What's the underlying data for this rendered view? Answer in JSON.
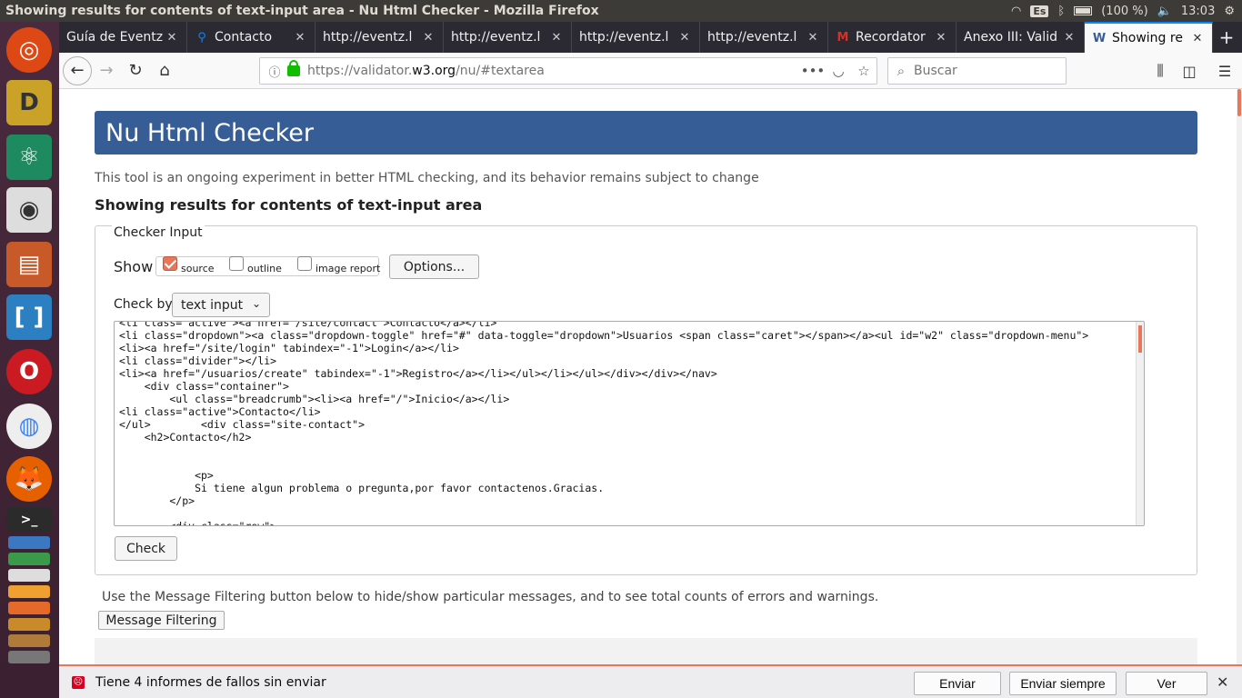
{
  "window": {
    "title": "Showing results for contents of text-input area - Nu Html Checker - Mozilla Firefox"
  },
  "tray": {
    "keyboard": "Es",
    "battery": "(100 %)",
    "time": "13:03"
  },
  "tabs": [
    {
      "label": "Guía de Eventz",
      "favicon": ""
    },
    {
      "label": "Contacto",
      "favicon": "map-pin"
    },
    {
      "label": "http://eventz.l",
      "favicon": ""
    },
    {
      "label": "http://eventz.l",
      "favicon": ""
    },
    {
      "label": "http://eventz.l",
      "favicon": ""
    },
    {
      "label": "http://eventz.l",
      "favicon": ""
    },
    {
      "label": "Recordator",
      "favicon": "gmail"
    },
    {
      "label": "Anexo III: Valid",
      "favicon": ""
    },
    {
      "label": "Showing re",
      "favicon": "w3c",
      "active": true
    }
  ],
  "urlbar": {
    "prefix": "https://validator.",
    "host": "w3.org",
    "path": "/nu/#textarea",
    "more": "•••"
  },
  "searchbar": {
    "placeholder": "Buscar"
  },
  "page": {
    "banner": "Nu Html Checker",
    "tagline": "This tool is an ongoing experiment in better HTML checking, and its behavior remains subject to change",
    "results_heading": "Showing results for contents of text-input area",
    "legend": "Checker Input",
    "show_label": "Show",
    "show_options": [
      {
        "label": "source",
        "checked": true
      },
      {
        "label": "outline",
        "checked": false
      },
      {
        "label": "image report",
        "checked": false
      }
    ],
    "options_button": "Options...",
    "checkby_label": "Check by",
    "checkby_value": "text input",
    "source_text": "<li class=\"active\"><a href=\"/site/contact\">Contacto</a></li>\n<li class=\"dropdown\"><a class=\"dropdown-toggle\" href=\"#\" data-toggle=\"dropdown\">Usuarios <span class=\"caret\"></span></a><ul id=\"w2\" class=\"dropdown-menu\">\n<li><a href=\"/site/login\" tabindex=\"-1\">Login</a></li>\n<li class=\"divider\"></li>\n<li><a href=\"/usuarios/create\" tabindex=\"-1\">Registro</a></li></ul></li></ul></div></div></nav>\n    <div class=\"container\">\n        <ul class=\"breadcrumb\"><li><a href=\"/\">Inicio</a></li>\n<li class=\"active\">Contacto</li>\n</ul>        <div class=\"site-contact\">\n    <h2>Contacto</h2>\n\n\n            <p>\n            Si tiene algun problema o pregunta,por favor contactenos.Gracias.\n        </p>\n\n        <div class=\"row\">",
    "check_button": "Check",
    "filter_text": "Use the Message Filtering button below to hide/show particular messages, and to see total counts of errors and warnings.",
    "filter_button": "Message Filtering"
  },
  "notification": {
    "message": "Tiene 4 informes de fallos sin enviar",
    "send": "Enviar",
    "send_always": "Enviar siempre",
    "view": "Ver"
  }
}
